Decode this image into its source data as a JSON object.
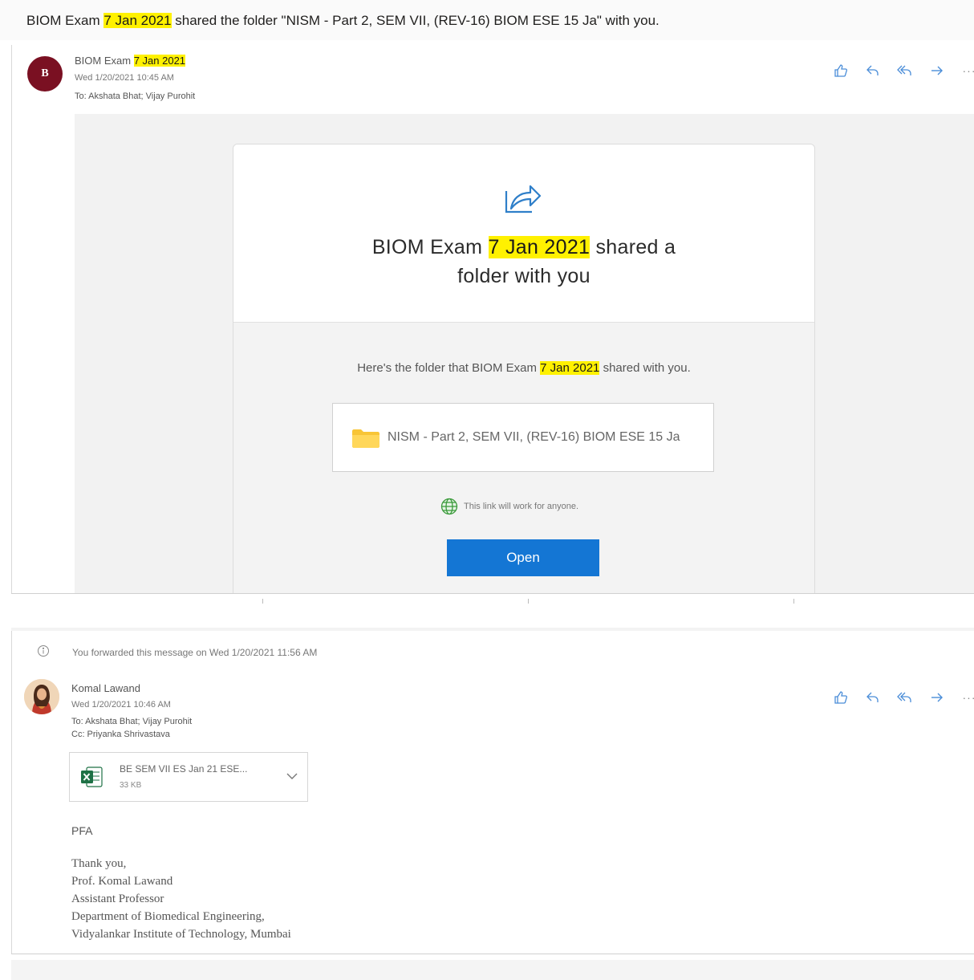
{
  "subject": {
    "prefix": "BIOM Exam",
    "highlight": "7 Jan 2021",
    "suffix": "shared the folder \"NISM - Part 2, SEM VII, (REV-16) BIOM ESE 15 Ja\" with you."
  },
  "message1": {
    "avatar_initial": "B",
    "avatar_color": "#7a1022",
    "sender_name": "BIOM Exam",
    "sender_highlight": "7 Jan 2021",
    "datetime": "Wed 1/20/2021 10:45 AM",
    "to": "To:  Akshata Bhat;  Vijay Purohit",
    "card": {
      "title_prefix": "BIOM Exam",
      "title_highlight": "7 Jan 2021",
      "title_suffix_line1": "shared a",
      "title_line2": "folder with you",
      "desc_prefix": "Here's the folder that BIOM Exam",
      "desc_highlight": "7 Jan 2021",
      "desc_suffix": "shared with you.",
      "folder_name": "NISM - Part 2, SEM VII, (REV-16) BIOM ESE 15 Ja",
      "link_note": "This link will work for anyone.",
      "open_label": "Open"
    }
  },
  "message2": {
    "forward_note": "You forwarded this message on Wed 1/20/2021 11:56 AM",
    "sender_name": "Komal Lawand",
    "datetime": "Wed 1/20/2021 10:46 AM",
    "to": "To:  Akshata Bhat;  Vijay Purohit",
    "cc": "Cc:  Priyanka Shrivastava",
    "attachment": {
      "name": "BE SEM VII ES Jan 21 ESE...",
      "size": "33 KB"
    },
    "body_greeting": "PFA",
    "signature": [
      "Thank you,",
      "Prof. Komal Lawand",
      "Assistant Professor",
      "Department of Biomedical Engineering,",
      "Vidyalankar Institute of Technology, Mumbai"
    ]
  },
  "actions": {
    "like_icon": "thumbs-up-icon",
    "reply_icon": "reply-icon",
    "reply_all_icon": "reply-all-icon",
    "forward_icon": "forward-icon",
    "more_label": "···"
  },
  "colors": {
    "highlight": "#fff100",
    "accent": "#1476d4",
    "icon_blue": "#4a8dd8"
  }
}
